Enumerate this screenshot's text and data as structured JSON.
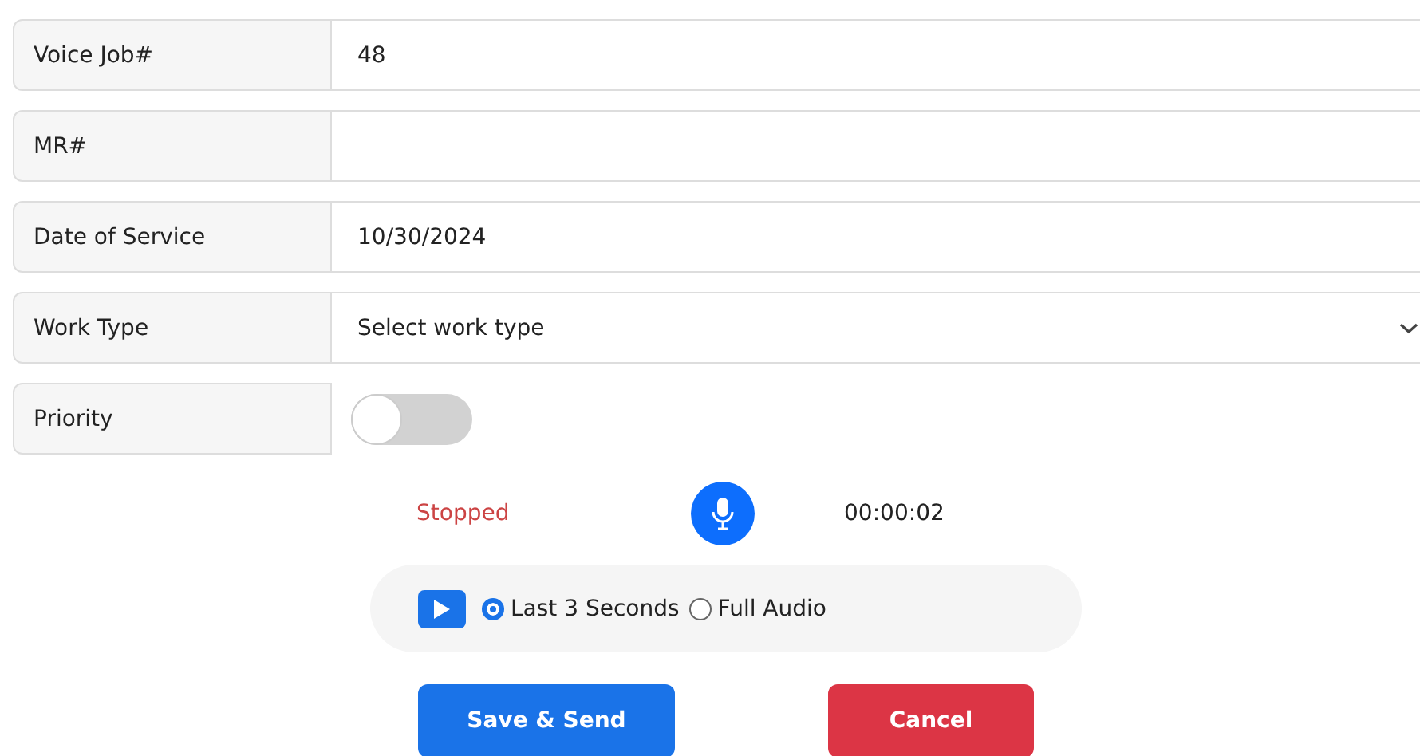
{
  "fields": [
    {
      "kind": "text",
      "label": "Voice Job#",
      "value": "48"
    },
    {
      "kind": "text",
      "label": "MR#"
    },
    {
      "kind": "text",
      "label": "Date of Service",
      "value": "10/30/2024"
    },
    {
      "kind": "select",
      "label": "Work Type",
      "value": "Select work type"
    },
    {
      "kind": "toggle",
      "label": "Priority",
      "on": false
    }
  ],
  "recorder": {
    "status": "Stopped",
    "timer": "00:00:02"
  },
  "playback": {
    "options": [
      {
        "label": "Last 3 Seconds",
        "selected": true
      },
      {
        "label": "Full Audio",
        "selected": false
      }
    ]
  },
  "buttons": [
    {
      "kind": "primary",
      "label": "Save & Send"
    },
    {
      "kind": "danger",
      "label": "Cancel"
    }
  ]
}
